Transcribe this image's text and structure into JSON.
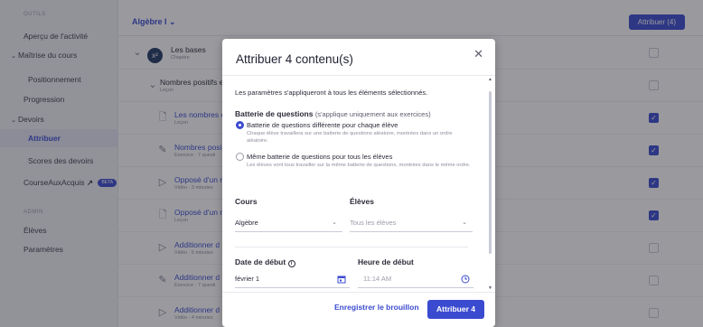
{
  "sidebar": {
    "section_tools": "OUTILS",
    "overview": "Aperçu de l'activité",
    "mastery": "Maîtrise du cours",
    "placement": "Positionnement",
    "progression": "Progression",
    "assignments": "Devoirs",
    "assign": "Attribuer",
    "scores": "Scores des devoirs",
    "course_race": "CourseAuxAcquis",
    "beta": "BETA",
    "section_admin": "ADMIN",
    "students": "Élèves",
    "settings": "Paramètres"
  },
  "topbar": {
    "breadcrumb": "Algèbre I",
    "assign_button": "Attribuer (4)"
  },
  "rows": [
    {
      "title": "Les bases",
      "sub": "Chapitre",
      "checked": false
    },
    {
      "title": "Nombres positifs e",
      "sub": "Leçon",
      "checked": false
    },
    {
      "title": "Les nombres e",
      "sub": "Leçon",
      "checked": true
    },
    {
      "title": "Nombres posi",
      "sub": "Exercice · 7 questi",
      "checked": true
    },
    {
      "title": "Opposé d'un r",
      "sub": "Vidéo · 3 minutes",
      "checked": true
    },
    {
      "title": "Opposé d'un r",
      "sub": "Leçon",
      "checked": true
    },
    {
      "title": "Additionner d",
      "sub": "Vidéo · 5 minutes",
      "checked": false
    },
    {
      "title": "Additionner d",
      "sub": "Exercice · 7 questi",
      "checked": false
    },
    {
      "title": "Additionner d",
      "sub": "Vidéo · 4 minutes",
      "checked": false
    }
  ],
  "modal": {
    "title": "Attribuer 4 contenu(s)",
    "intro": "Les paramètres s'appliqueront à tous les éléments sélectionnés.",
    "bank_label": "Batterie de questions",
    "bank_hint": "(s'applique uniquement aux exercices)",
    "option1_label": "Batterie de questions différente pour chaque élève",
    "option1_desc": "Chaque élève travaillera sur une batterie de questions aléatoire, montrées dans un ordre aléatoire.",
    "option2_label": "Même batterie de questions pour tous les élèves",
    "option2_desc": "Les élèves vont tous travailler sur la même batterie de questions, montrées dans le même ordre.",
    "course_label": "Cours",
    "course_value": "Algèbre",
    "students_label": "Élèves",
    "students_value": "Tous les élèves",
    "start_date_label": "Date de début",
    "start_date_value": "février 1",
    "start_time_label": "Heure de début",
    "start_time_value": "11:14 AM",
    "draft_button": "Enregistrer le brouillon",
    "assign_button": "Attribuer 4"
  },
  "colors": {
    "accent": "#3b4bd0",
    "overlay": "rgba(30,30,40,0.45)"
  }
}
